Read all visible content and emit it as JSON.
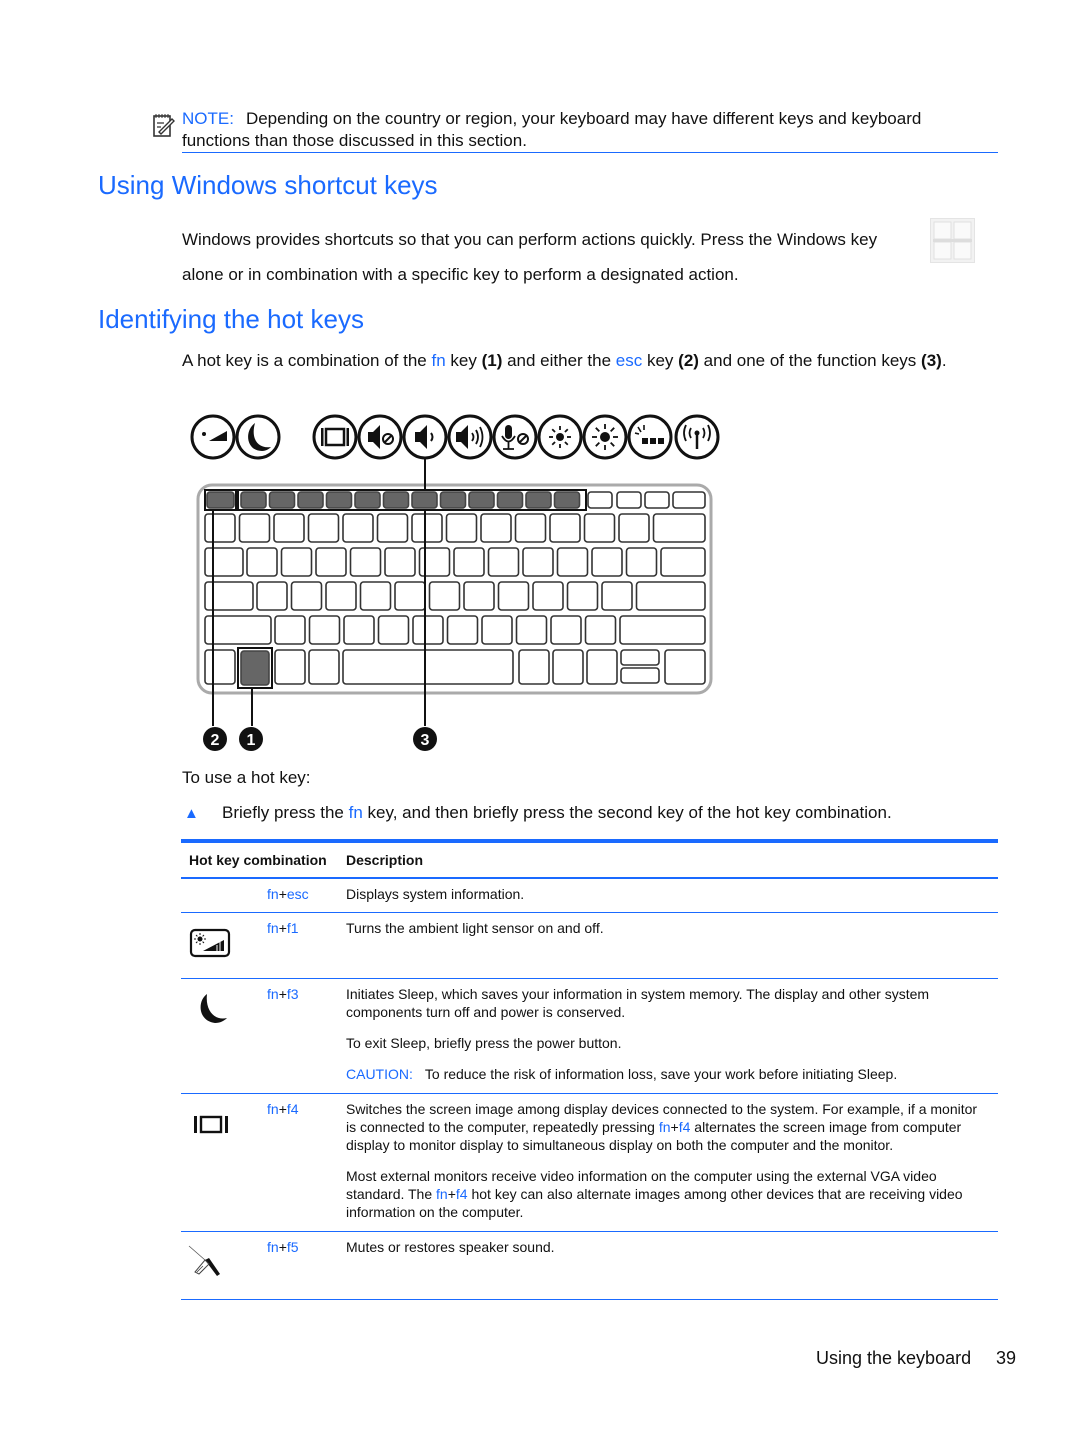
{
  "note": {
    "icon": "note-pencil-icon",
    "label": "NOTE:",
    "text": "Depending on the country or region, your keyboard may have different keys and keyboard functions than those discussed in this section."
  },
  "section_windows": {
    "heading": "Using Windows shortcut keys",
    "line1": "Windows provides shortcuts so that you can perform actions quickly. Press the Windows key",
    "windows_key_icon": "windows-key-icon",
    "line2": "alone or in combination with a specific key to perform a designated action."
  },
  "section_hotkeys": {
    "heading": "Identifying the hot keys",
    "intro": {
      "t1": "A hot key is a combination of the ",
      "fn": "fn",
      "t2": " key ",
      "n1": "(1)",
      "t3": " and either the ",
      "esc": "esc",
      "t4": " key ",
      "n2": "(2)",
      "t5": " and one of the function keys ",
      "n3": "(3)",
      "t6": "."
    },
    "diagram": {
      "icons": [
        "ambient-light-sensor-icon",
        "sleep-icon",
        "display-switch-icon",
        "mute-icon",
        "volume-down-icon",
        "volume-up-icon",
        "mic-mute-icon",
        "brightness-down-icon",
        "brightness-up-icon",
        "keyboard-backlight-icon",
        "wireless-icon"
      ],
      "callouts": [
        "2",
        "1",
        "3"
      ]
    },
    "use_label": "To use a hot key:",
    "step": {
      "t1": "Briefly press the ",
      "fn": "fn",
      "t2": " key, and then briefly press the second key of the hot key combination."
    }
  },
  "table": {
    "headers": [
      "Hot key combination",
      "Description"
    ],
    "rows": [
      {
        "icon": "",
        "key_a": "fn",
        "plus": "+",
        "key_b": "esc",
        "paragraphs": [
          "Displays system information."
        ]
      },
      {
        "icon": "ambient-light-sensor-icon",
        "key_a": "fn",
        "plus": "+",
        "key_b": "f1",
        "paragraphs": [
          "Turns the ambient light sensor on and off."
        ]
      },
      {
        "icon": "sleep-icon",
        "key_a": "fn",
        "plus": "+",
        "key_b": "f3",
        "paragraphs": [
          "Initiates Sleep, which saves your information in system memory. The display and other system components turn off and power is conserved.",
          "To exit Sleep, briefly press the power button."
        ],
        "caution_label": "CAUTION:",
        "caution_text": "To reduce the risk of information loss, save your work before initiating Sleep."
      },
      {
        "icon": "display-switch-icon",
        "key_a": "fn",
        "plus": "+",
        "key_b": "f4",
        "p1_a": "Switches the screen image among display devices connected to the system. For example, if a monitor is connected to the computer, repeatedly pressing ",
        "p1_key": "fn",
        "p1_plus": "+",
        "p1_key2": "f4",
        "p1_b": " alternates the screen image from computer display to monitor display to simultaneous display on both the computer and the monitor.",
        "p2_a": "Most external monitors receive video information on the computer using the external VGA video standard. The ",
        "p2_key": "fn",
        "p2_plus": "+",
        "p2_key2": "f4",
        "p2_b": " hot key can also alternate images among other devices that are receiving video information on the computer."
      },
      {
        "icon": "mute-pen-icon",
        "key_a": "fn",
        "plus": "+",
        "key_b": "f5",
        "paragraphs": [
          "Mutes or restores speaker sound."
        ]
      }
    ]
  },
  "footer": {
    "section": "Using the keyboard",
    "page": "39"
  },
  "colors": {
    "accent": "#1a6aff",
    "text": "#111111"
  }
}
